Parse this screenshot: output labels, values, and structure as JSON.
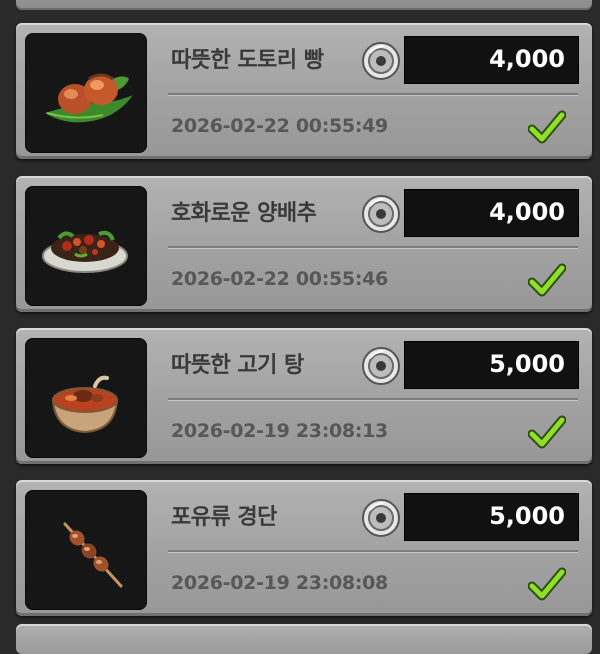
{
  "purchases": [
    {
      "name": "따뜻한 도토리 빵",
      "price": "4,000",
      "date": "2026-02-22 00:55:49",
      "thumbnail_icon": "acorn-bread-icon"
    },
    {
      "name": "호화로운 양배추",
      "price": "4,000",
      "date": "2026-02-22 00:55:46",
      "thumbnail_icon": "cabbage-dish-icon"
    },
    {
      "name": "따뜻한 고기 탕",
      "price": "5,000",
      "date": "2026-02-19 23:08:13",
      "thumbnail_icon": "meat-soup-icon"
    },
    {
      "name": "포유류 경단",
      "price": "5,000",
      "date": "2026-02-19 23:08:08",
      "thumbnail_icon": "meat-skewer-icon"
    }
  ],
  "currency_icon": "coin-icon",
  "status_icon": "check-icon",
  "colors": {
    "card": "#a6a6a6",
    "price_box": "#111111",
    "price_text": "#ffffff",
    "check": "#8ee02a"
  }
}
